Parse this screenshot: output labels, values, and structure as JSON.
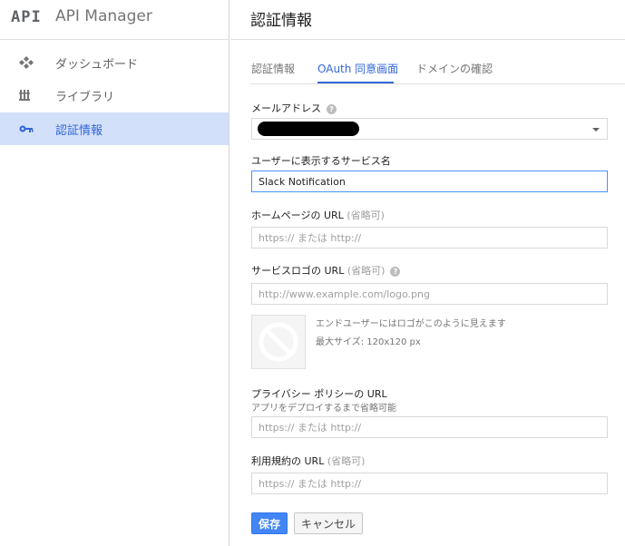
{
  "brand": {
    "logo": "API",
    "title": "API Manager"
  },
  "sidebar": {
    "items": [
      {
        "label": "ダッシュボード",
        "icon": "dashboard-icon",
        "active": false
      },
      {
        "label": "ライブラリ",
        "icon": "library-icon",
        "active": false
      },
      {
        "label": "認証情報",
        "icon": "key-icon",
        "active": true
      }
    ]
  },
  "page": {
    "title": "認証情報"
  },
  "tabs": [
    {
      "label": "認証情報",
      "active": false
    },
    {
      "label": "OAuth 同意画面",
      "active": true
    },
    {
      "label": "ドメインの確認",
      "active": false
    }
  ],
  "form": {
    "email": {
      "label": "メールアドレス",
      "value": ""
    },
    "service_name": {
      "label": "ユーザーに表示するサービス名",
      "value": "Slack Notification"
    },
    "homepage": {
      "label": "ホームページの URL",
      "optional": "(省略可)",
      "placeholder": "https:// または http://"
    },
    "logo_url": {
      "label": "サービスロゴの URL",
      "optional": "(省略可)",
      "placeholder": "http://www.example.com/logo.png"
    },
    "logo_preview": {
      "hint": "エンドユーザーにはロゴがこのように見えます",
      "size": "最大サイズ: 120x120 px"
    },
    "privacy": {
      "label": "プライバシー ポリシーの URL",
      "sublabel": "アプリをデプロイするまで省略可能",
      "placeholder": "https:// または http://"
    },
    "terms": {
      "label": "利用規約の URL",
      "optional": "(省略可)",
      "placeholder": "https:// または http://"
    }
  },
  "buttons": {
    "save": "保存",
    "cancel": "キャンセル"
  },
  "colors": {
    "accent": "#3367d6",
    "primary_button": "#4285f4",
    "active_nav_bg": "#d2e0f9"
  }
}
